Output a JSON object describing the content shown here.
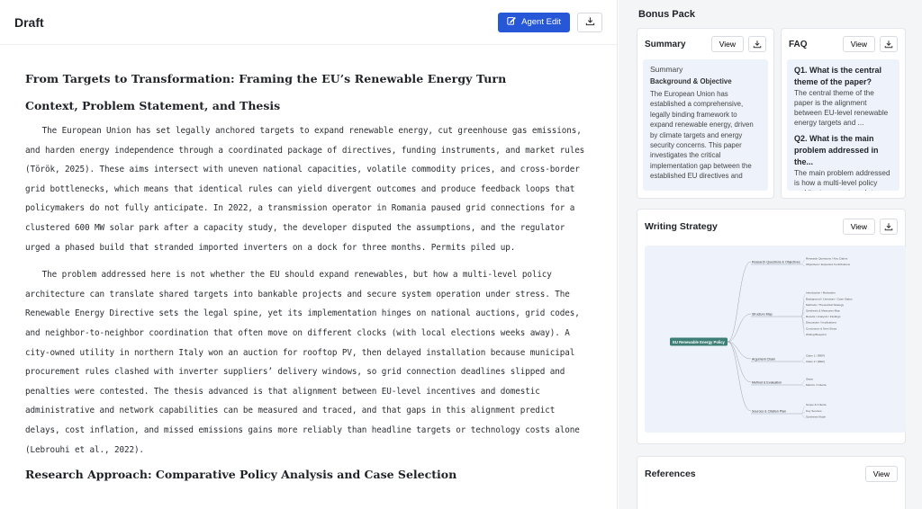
{
  "draft": {
    "title": "Draft",
    "agent_edit_label": "Agent Edit"
  },
  "document": {
    "title": "From Targets to Transformation: Framing the EU’s Renewable Energy Turn",
    "section1": "Context, Problem Statement, and Thesis",
    "p1": "The European Union has set legally anchored targets to expand renewable energy, cut greenhouse gas emissions, and harden energy independence through a coordinated package of directives, funding instruments, and market rules (Török, 2025). These aims intersect with uneven national capacities, volatile commodity prices, and cross-border grid bottlenecks, which means that identical rules can yield divergent outcomes and produce feedback loops that policymakers do not fully anticipate. In 2022, a transmission operator in Romania paused grid connections for a clustered 600 MW solar park after a capacity study, the developer disputed the assumptions, and the regulator urged a phased build that stranded imported inverters on a dock for three months. Permits piled up.",
    "p2": "The problem addressed here is not whether the EU should expand renewables, but how a multi-level policy architecture can translate shared targets into bankable projects and secure system operation under stress. The Renewable Energy Directive sets the legal spine, yet its implementation hinges on national auctions, grid codes, and neighbor-to-neighbor coordination that often move on different clocks (with local elections weeks away). A city-owned utility in northern Italy won an auction for rooftop PV, then delayed installation because municipal procurement rules clashed with inverter suppliers’ delivery windows, so grid connection deadlines slipped and penalties were contested. The thesis advanced is that alignment between EU-level incentives and domestic administrative and network capabilities can be measured and traced, and that gaps in this alignment predict delays, cost inflation, and missed emissions gains more reliably than headline targets or technology costs alone (Lebrouhi et al., 2022).",
    "section2": "Research Approach: Comparative Policy Analysis and Case Selection"
  },
  "bonus": {
    "title": "Bonus Pack",
    "view_label": "View",
    "summary": {
      "title": "Summary",
      "heading": "Summary",
      "subheading": "Background & Objective",
      "text": "The European Union has established a comprehensive, legally binding framework to expand renewable energy, driven by climate targets and energy security concerns. This paper investigates the critical implementation gap between the established EU directives and"
    },
    "faq": {
      "title": "FAQ",
      "items": [
        {
          "q": "Q1. What is the central theme of the paper?",
          "a": "The central theme of the paper is the alignment between EU-level renewable energy targets and ..."
        },
        {
          "q": "Q2. What is the main problem addressed in the...",
          "a": "The main problem addressed is how a multi-level policy architecture can translate shar..."
        }
      ]
    },
    "strategy": {
      "title": "Writing Strategy",
      "root": "EU Renewable Energy Policy",
      "branches": [
        {
          "label": "Research Questions & Objectives",
          "leaves": [
            "Research Questions / Key Claims",
            "Objectives / Expected Contributions"
          ]
        },
        {
          "label": "Structure Map",
          "leaves": [
            "Introduction / Motivation",
            "Background / Literature / Case Status",
            "Methods / Theoretical Strategy",
            "Synthesis & Measures Map",
            "Results / Analysis / Findings",
            "Discussion / Implications",
            "Conclusion & Next Steps",
            "Writing Blueprint"
          ]
        },
        {
          "label": "Argument Chain",
          "leaves": [
            "Claim 1 / [REF]",
            "Claim 2 / [REF]"
          ]
        },
        {
          "label": "Method & Evaluation",
          "leaves": [
            "Steps",
            "Metrics / Criteria"
          ]
        },
        {
          "label": "Sources & Citation Plan",
          "leaves": [
            "Scope & Criteria",
            "Key Sources",
            "Synthesis Mode"
          ]
        }
      ]
    },
    "references": {
      "title": "References"
    }
  }
}
